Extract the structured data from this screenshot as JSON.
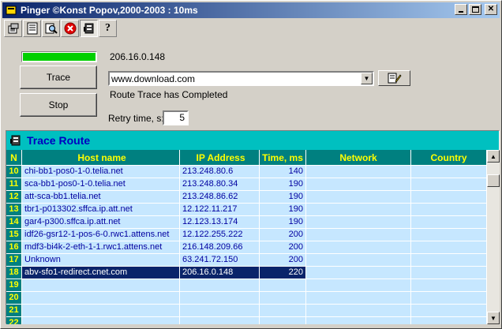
{
  "window": {
    "title": "Pinger ©Konst Popov,2000-2003 : 10ms"
  },
  "progress": {
    "value": 1.0,
    "color": "#00d000"
  },
  "current_ip": "206.16.0.148",
  "buttons": {
    "trace": "Trace",
    "stop": "Stop"
  },
  "host_combo": {
    "value": "www.download.com"
  },
  "status_text": "Route Trace has Completed",
  "retry": {
    "label": "Retry time, s:",
    "value": "5"
  },
  "panel": {
    "title": "Trace Route"
  },
  "table": {
    "columns": [
      "N",
      "Host name",
      "IP Address",
      "Time, ms",
      "Network",
      "Country"
    ],
    "rows": [
      {
        "n": "10",
        "host": "chi-bb1-pos0-1-0.telia.net",
        "ip": "213.248.80.6",
        "time": "140",
        "network": "",
        "country": ""
      },
      {
        "n": "11",
        "host": "sca-bb1-pos0-1-0.telia.net",
        "ip": "213.248.80.34",
        "time": "190",
        "network": "",
        "country": ""
      },
      {
        "n": "12",
        "host": "att-sca-bb1.telia.net",
        "ip": "213.248.86.62",
        "time": "190",
        "network": "",
        "country": ""
      },
      {
        "n": "13",
        "host": "tbr1-p013302.sffca.ip.att.net",
        "ip": "12.122.11.217",
        "time": "190",
        "network": "",
        "country": ""
      },
      {
        "n": "14",
        "host": "gar4-p300.sffca.ip.att.net",
        "ip": "12.123.13.174",
        "time": "190",
        "network": "",
        "country": ""
      },
      {
        "n": "15",
        "host": "idf26-gsr12-1-pos-6-0.rwc1.attens.net",
        "ip": "12.122.255.222",
        "time": "200",
        "network": "",
        "country": ""
      },
      {
        "n": "16",
        "host": "mdf3-bi4k-2-eth-1-1.rwc1.attens.net",
        "ip": "216.148.209.66",
        "time": "200",
        "network": "",
        "country": ""
      },
      {
        "n": "17",
        "host": "Unknown",
        "ip": "63.241.72.150",
        "time": "200",
        "network": "",
        "country": ""
      },
      {
        "n": "18",
        "host": "abv-sfo1-redirect.cnet.com",
        "ip": "206.16.0.148",
        "time": "220",
        "network": "",
        "country": "",
        "selected": true
      },
      {
        "n": "19",
        "host": "",
        "ip": "",
        "time": "",
        "network": "",
        "country": ""
      },
      {
        "n": "20",
        "host": "",
        "ip": "",
        "time": "",
        "network": "",
        "country": ""
      },
      {
        "n": "21",
        "host": "",
        "ip": "",
        "time": "",
        "network": "",
        "country": ""
      },
      {
        "n": "22",
        "host": "",
        "ip": "",
        "time": "",
        "network": "",
        "country": ""
      }
    ]
  },
  "colors": {
    "header_bg": "#008080",
    "header_text": "#ffff00",
    "row_bg": "#c6e7ff",
    "row_text": "#0000a0",
    "selected_bg": "#0a246a",
    "panel_bg": "#00c0c0",
    "title_gradient_start": "#0a246a"
  }
}
